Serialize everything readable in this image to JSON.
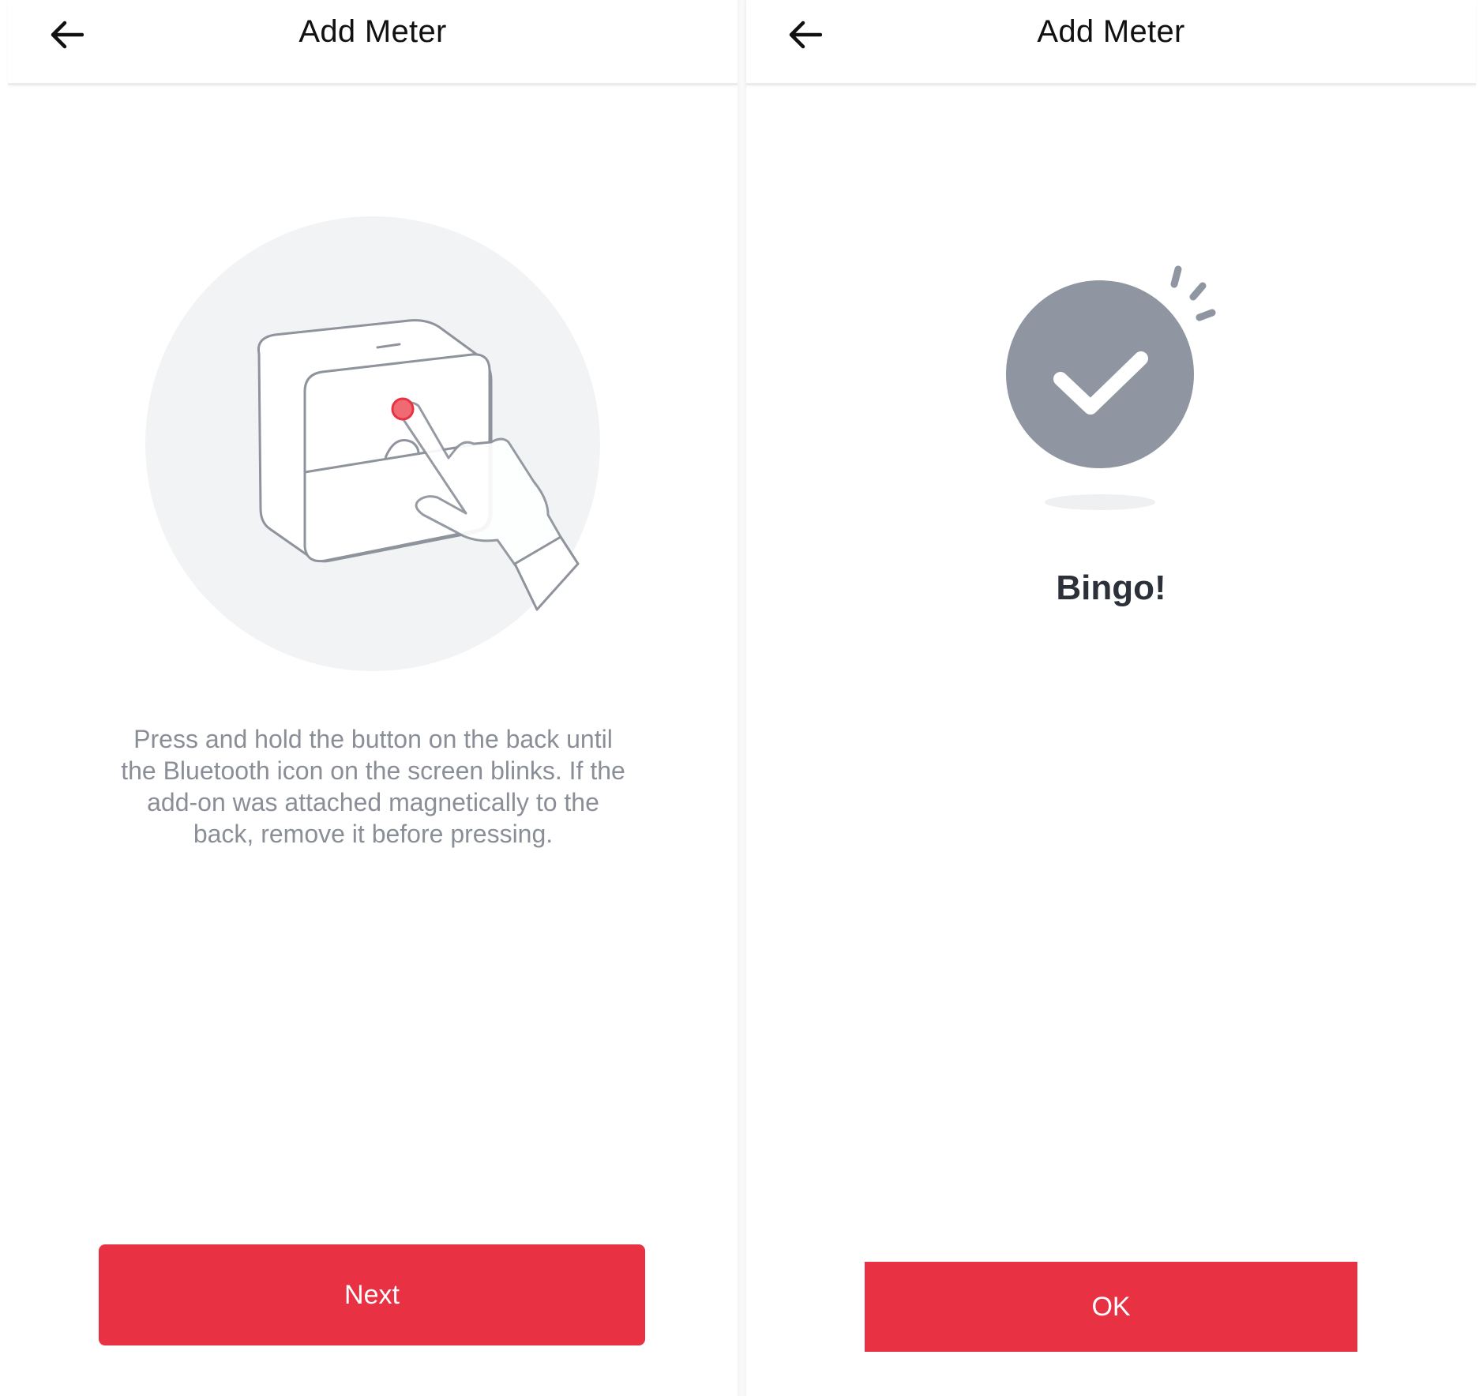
{
  "screens": [
    {
      "header": {
        "title": "Add Meter"
      },
      "instruction": "Press and hold the button on the back until the Bluetooth icon on the screen blinks. If the add-on was attached magnetically to the back, remove it before pressing.",
      "primary_button": "Next"
    },
    {
      "header": {
        "title": "Add Meter"
      },
      "success_title": "Bingo!",
      "primary_button": "OK"
    }
  ],
  "icons": {
    "back": "arrow-left-icon",
    "success": "checkmark-circle-icon",
    "illustration": "device-press-button-illustration"
  },
  "colors": {
    "accent": "#e83143",
    "title_text": "#111111",
    "body_text": "#8a8f97",
    "icon_gray": "#8f96a1",
    "illustration_bg": "#f2f3f5",
    "device_stroke": "#8e939c",
    "indicator_red": "#e83143"
  }
}
